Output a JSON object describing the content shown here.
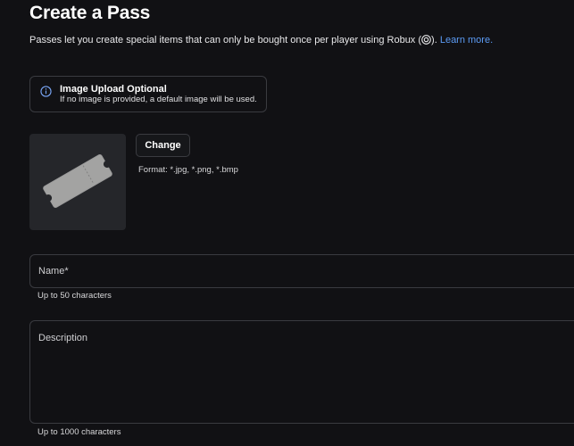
{
  "page": {
    "title": "Create a Pass",
    "subtitle_before": "Passes let you create special items that can only be bought once per player using Robux (",
    "subtitle_after": ").",
    "learn_more": "Learn more.",
    "robux_icon": "robux-icon"
  },
  "notice": {
    "icon": "info-icon",
    "title": "Image Upload Optional",
    "body": "If no image is provided, a default image will be used."
  },
  "image": {
    "preview": "ticket-image",
    "change_label": "Change",
    "format_text": "Format: *.jpg, *.png, *.bmp"
  },
  "form": {
    "name_label": "Name",
    "name_required": "*",
    "name_hint": "Up to 50 characters",
    "description_label": "Description",
    "description_hint": "Up to 1000 characters"
  },
  "colors": {
    "background": "#111114",
    "border": "#3a3b40",
    "link": "#5c9cf5",
    "info_icon": "#7aa7f7",
    "thumbnail_bg": "#25262a"
  }
}
